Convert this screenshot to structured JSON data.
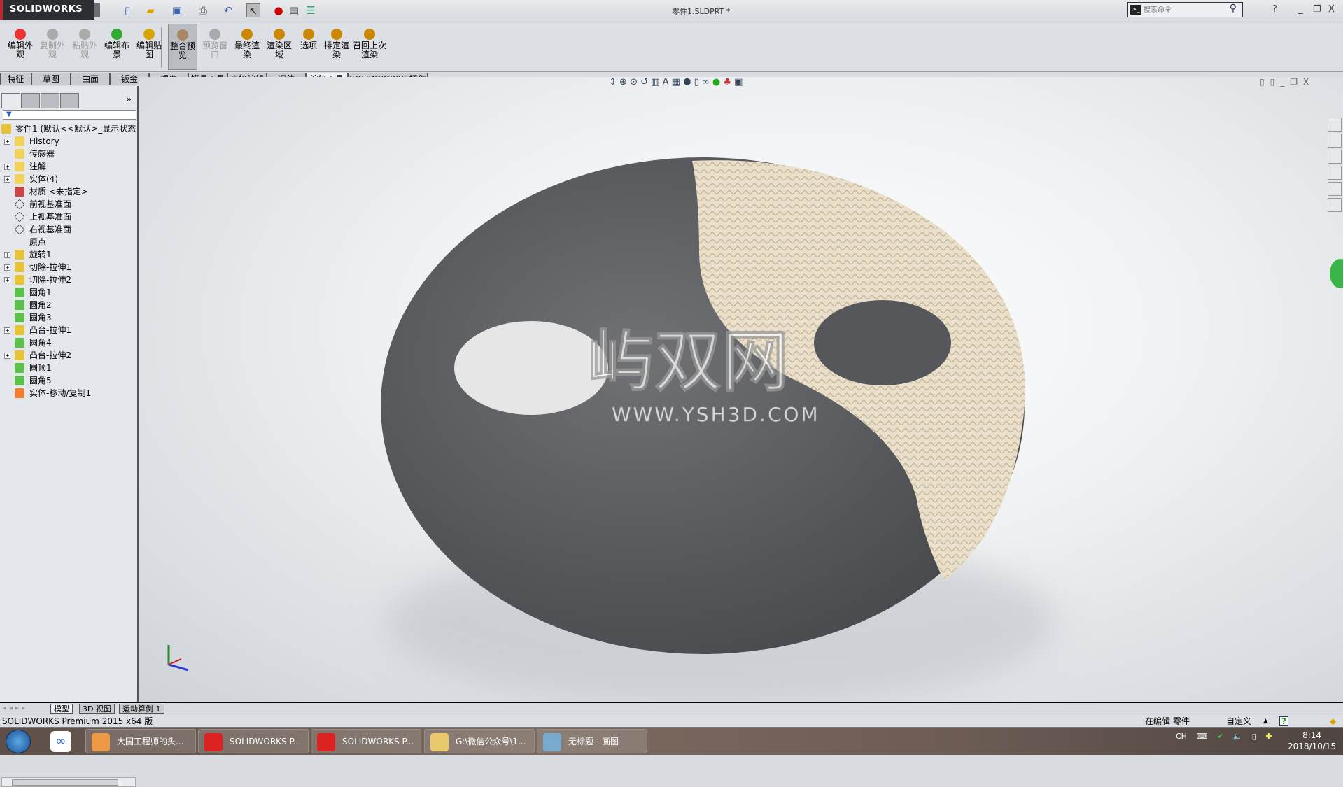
{
  "app": {
    "brand": "SOLIDWORKS",
    "document_title": "零件1.SLDPRT *"
  },
  "search": {
    "placeholder": "搜索命令"
  },
  "ribbon": {
    "buttons": [
      {
        "label": "编辑外观",
        "enabled": true
      },
      {
        "label": "复制外观",
        "enabled": false
      },
      {
        "label": "粘贴外观",
        "enabled": false
      },
      {
        "label": "编辑布景",
        "enabled": true
      },
      {
        "label": "编辑贴图",
        "enabled": true
      },
      {
        "label": "整合预览",
        "enabled": true,
        "active": true
      },
      {
        "label": "预览窗口",
        "enabled": false
      },
      {
        "label": "最终渲染",
        "enabled": true
      },
      {
        "label": "渲染区域",
        "enabled": true
      },
      {
        "label": "选项",
        "enabled": true
      },
      {
        "label": "排定渲染",
        "enabled": true
      },
      {
        "label": "召回上次渲染",
        "enabled": true
      }
    ]
  },
  "tabs": [
    "特征",
    "草图",
    "曲面",
    "钣金",
    "焊件",
    "模具工具",
    "直接编辑",
    "评估",
    "渲染工具",
    "SOLIDWORKS 插件"
  ],
  "active_tab": "渲染工具",
  "tree": {
    "root": "零件1 (默认<<默认>_显示状态",
    "items": [
      {
        "label": "History",
        "expandable": true,
        "icon": "history-folder"
      },
      {
        "label": "传感器",
        "expandable": false,
        "icon": "sensor-folder"
      },
      {
        "label": "注解",
        "expandable": true,
        "icon": "annotation-folder"
      },
      {
        "label": "实体(4)",
        "expandable": true,
        "icon": "solid-bodies-folder"
      },
      {
        "label": "材质 <未指定>",
        "expandable": false,
        "icon": "material"
      },
      {
        "label": "前视基准面",
        "expandable": false,
        "icon": "plane"
      },
      {
        "label": "上视基准面",
        "expandable": false,
        "icon": "plane"
      },
      {
        "label": "右视基准面",
        "expandable": false,
        "icon": "plane"
      },
      {
        "label": "原点",
        "expandable": false,
        "icon": "origin"
      },
      {
        "label": "旋转1",
        "expandable": true,
        "icon": "revolve"
      },
      {
        "label": "切除-拉伸1",
        "expandable": true,
        "icon": "cut-extrude"
      },
      {
        "label": "切除-拉伸2",
        "expandable": true,
        "icon": "cut-extrude"
      },
      {
        "label": "圆角1",
        "expandable": false,
        "icon": "fillet"
      },
      {
        "label": "圆角2",
        "expandable": false,
        "icon": "fillet"
      },
      {
        "label": "圆角3",
        "expandable": false,
        "icon": "fillet"
      },
      {
        "label": "凸台-拉伸1",
        "expandable": true,
        "icon": "boss-extrude"
      },
      {
        "label": "圆角4",
        "expandable": false,
        "icon": "fillet"
      },
      {
        "label": "凸台-拉伸2",
        "expandable": true,
        "icon": "boss-extrude"
      },
      {
        "label": "圆顶1",
        "expandable": false,
        "icon": "dome"
      },
      {
        "label": "圆角5",
        "expandable": false,
        "icon": "fillet"
      },
      {
        "label": "实体-移动/复制1",
        "expandable": false,
        "icon": "move-copy"
      }
    ]
  },
  "watermark": {
    "logo": "屿双网",
    "url": "WWW.YSH3D.COM"
  },
  "bottom_tabs": [
    "模型",
    "3D 视图",
    "运动算例 1"
  ],
  "status": {
    "version": "SOLIDWORKS Premium 2015 x64 版",
    "mode": "在编辑 零件",
    "units": "自定义",
    "help": "?"
  },
  "taskbar": {
    "items": [
      "大国工程师的头...",
      "SOLIDWORKS P...",
      "SOLIDWORKS P...",
      "G:\\微信公众号\\1...",
      "无标题 - 画图"
    ],
    "tray_lang": "CH",
    "time": "8:14",
    "date": "2018/10/15"
  },
  "colors": {
    "dark_fabric": "#5a5c60",
    "cream_knit": "#e8ddc8",
    "accent_red": "#c0282d"
  }
}
